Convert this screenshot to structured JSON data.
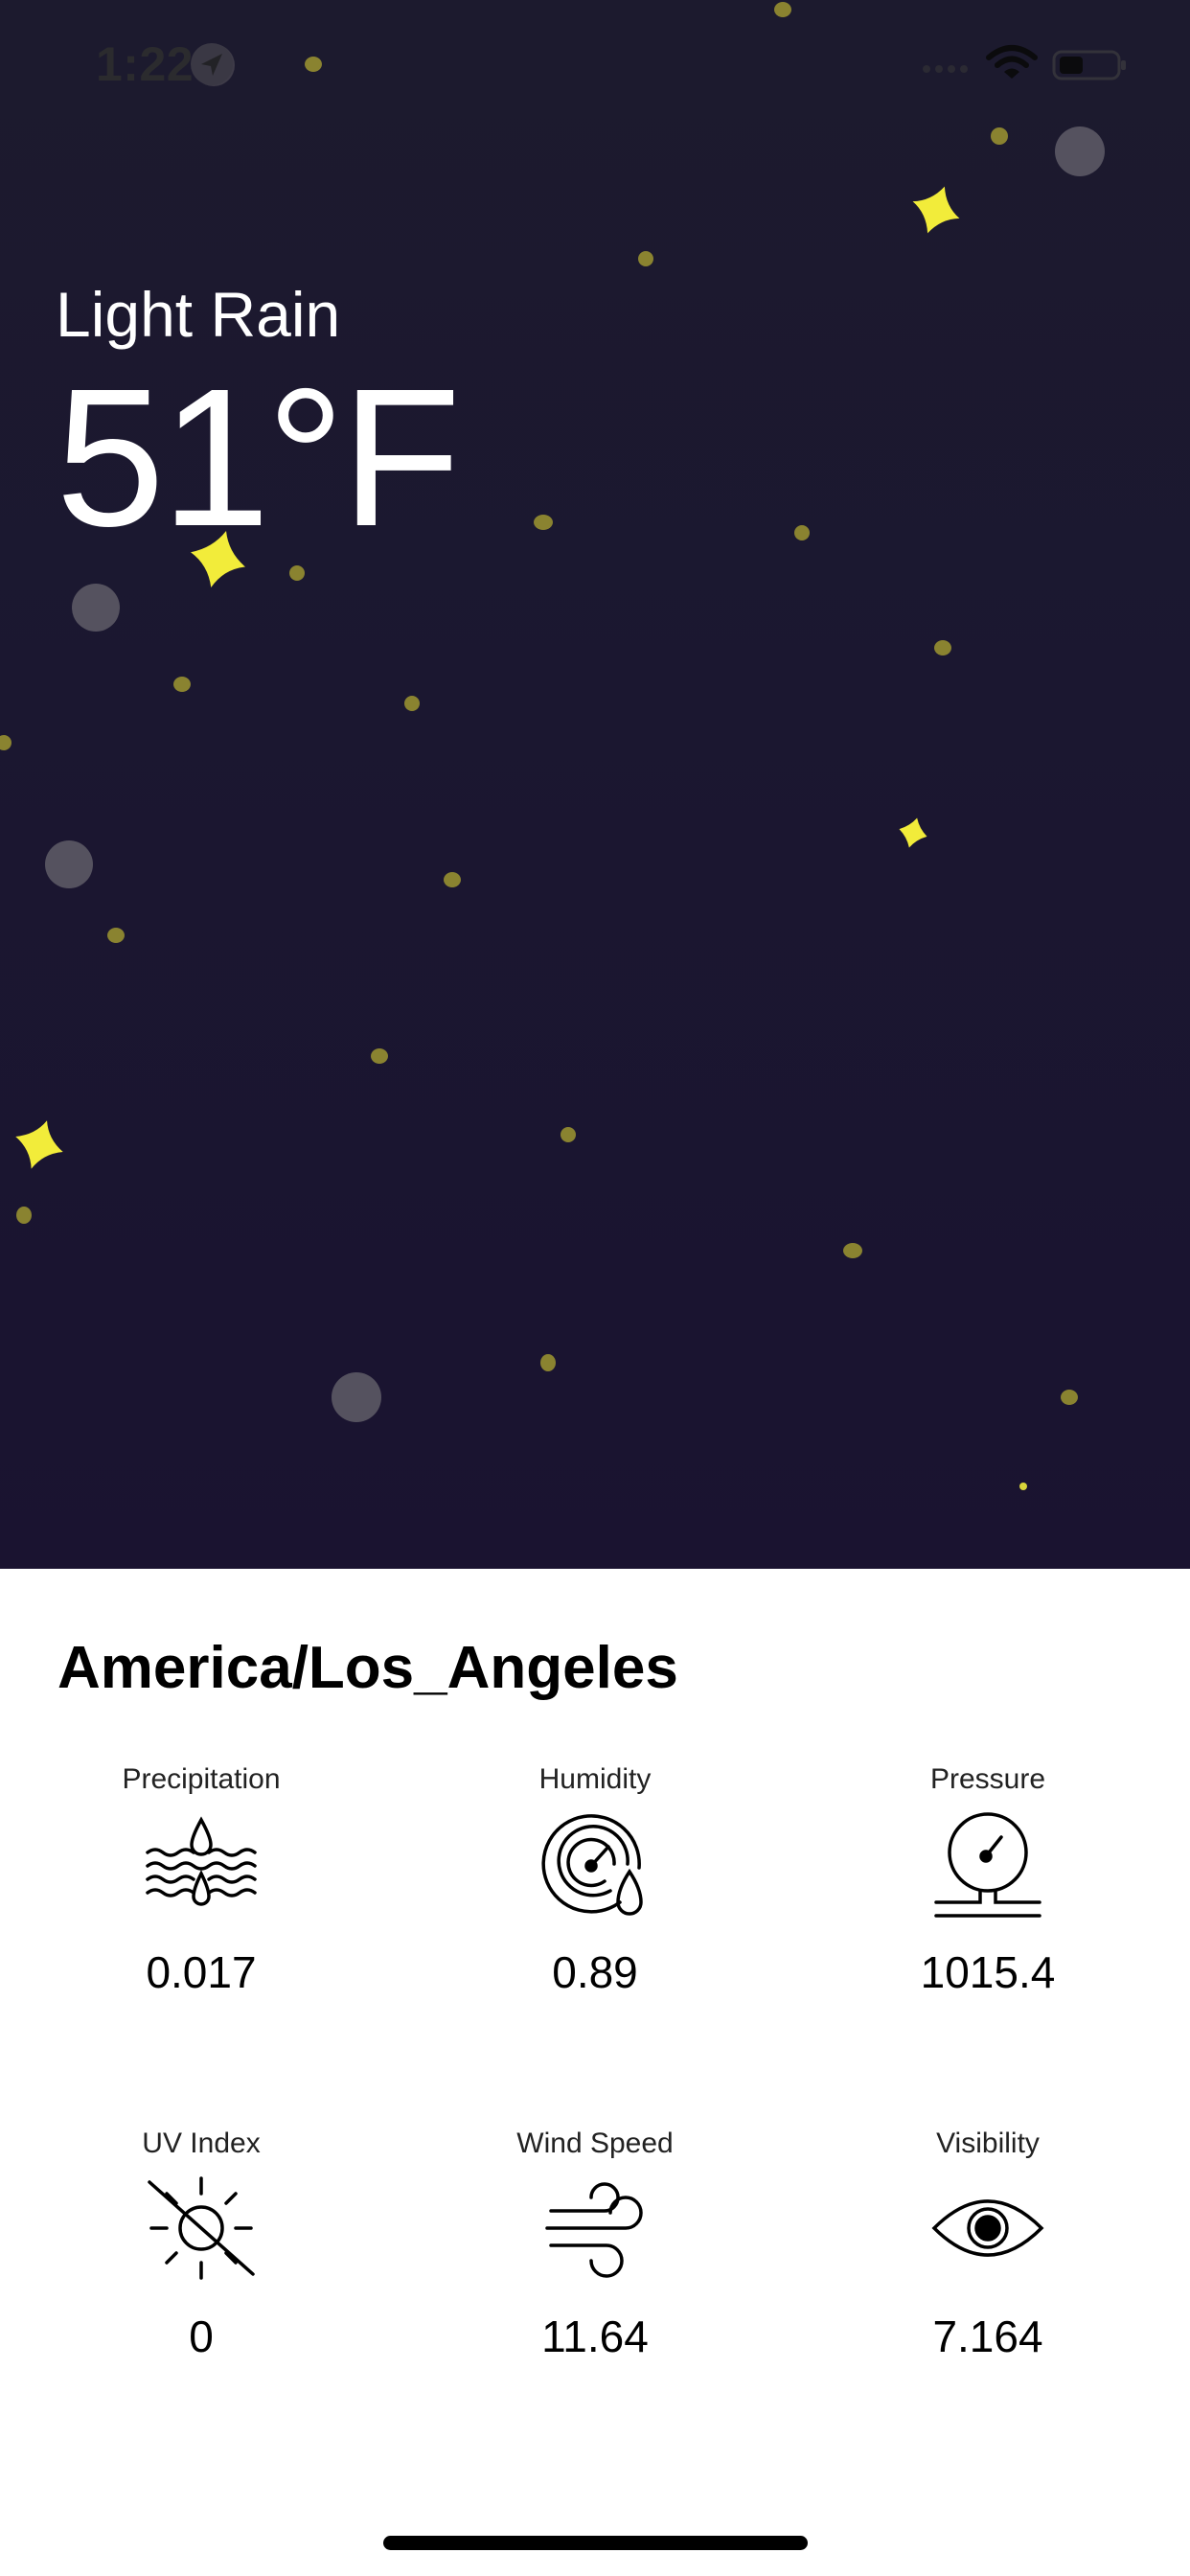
{
  "status_bar": {
    "time": "1:22",
    "icons": [
      "location-arrow-icon",
      "cellular-signal-icon",
      "wifi-icon",
      "battery-icon"
    ]
  },
  "weather": {
    "condition": "Light Rain",
    "temperature": "51°F"
  },
  "details": {
    "location": "America/Los_Angeles",
    "metrics": [
      {
        "label": "Precipitation",
        "value": "0.017",
        "icon": "precipitation-icon"
      },
      {
        "label": "Humidity",
        "value": "0.89",
        "icon": "humidity-icon"
      },
      {
        "label": "Pressure",
        "value": "1015.4",
        "icon": "pressure-icon"
      },
      {
        "label": "UV Index",
        "value": "0",
        "icon": "uv-index-icon"
      },
      {
        "label": "Wind Speed",
        "value": "11.64",
        "icon": "wind-speed-icon"
      },
      {
        "label": "Visibility",
        "value": "7.164",
        "icon": "visibility-icon"
      }
    ]
  },
  "colors": {
    "sky_top": "#1c1a2e",
    "sky_bottom": "#1a1330",
    "sparkle": "#f2ec3a",
    "dot": "#8a8330",
    "orb": "#55525f"
  }
}
